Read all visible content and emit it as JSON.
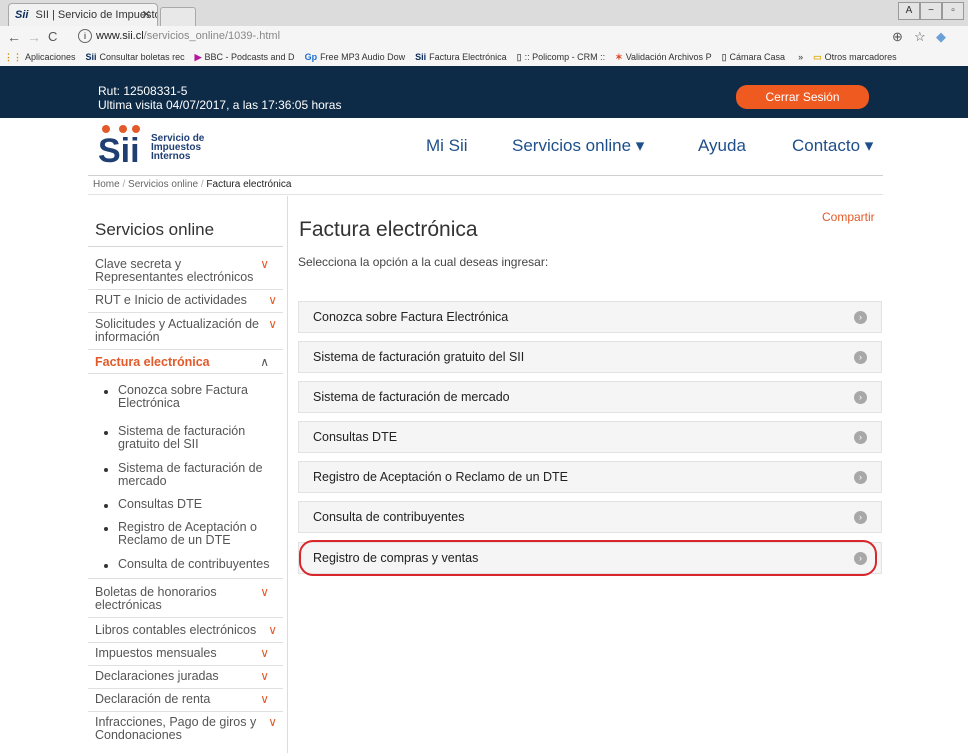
{
  "browser": {
    "tab_title": "SII | Servicio de Impuesto",
    "url_host": "www.sii.cl",
    "url_path": "/servicios_online/1039-.html",
    "bookmarks": [
      {
        "icon": "grid",
        "label": "Aplicaciones"
      },
      {
        "icon": "sii",
        "label": "Consultar boletas rec"
      },
      {
        "icon": "bbc",
        "label": "BBC - Podcasts and D"
      },
      {
        "icon": "mp3",
        "label": "Free MP3 Audio Dow"
      },
      {
        "icon": "sii",
        "label": "Factura Electrónica"
      },
      {
        "icon": "page",
        "label": ":: Policomp - CRM ::"
      },
      {
        "icon": "star",
        "label": "Validación Archivos P"
      },
      {
        "icon": "page",
        "label": "Cámara Casa"
      },
      {
        "icon": "more",
        "label": "»"
      },
      {
        "icon": "folder",
        "label": "Otros marcadores"
      }
    ]
  },
  "session": {
    "rut": "Rut: 12508331-5",
    "last_visit": "Ultima visita 04/07/2017, a las 17:36:05 horas",
    "logout_label": "Cerrar Sesión"
  },
  "header": {
    "logo_letters": "Sii",
    "logo_text": [
      "Servicio de",
      "Impuestos",
      "Internos"
    ],
    "nav": [
      "Mi Sii",
      "Servicios online ▾",
      "Ayuda",
      "Contacto ▾"
    ]
  },
  "breadcrumb": [
    "Home",
    "Servicios online",
    "Factura electrónica"
  ],
  "sidebar": {
    "title": "Servicios online",
    "items": [
      "Clave secreta y Representantes electrónicos",
      "RUT e Inicio de actividades",
      "Solicitudes y Actualización de información",
      "Factura electrónica",
      "Boletas de honorarios electrónicas",
      "Libros contables electrónicos",
      "Impuestos mensuales",
      "Declaraciones juradas",
      "Declaración de renta",
      "Infracciones, Pago de giros y Condonaciones"
    ],
    "subitems": [
      "Conozca sobre Factura Electrónica",
      "Sistema de facturación gratuito del SII",
      "Sistema de facturación de mercado",
      "Consultas DTE",
      "Registro de Aceptación o Reclamo de un DTE",
      "Consulta de contribuyentes"
    ]
  },
  "main": {
    "share": "Compartir",
    "title": "Factura electrónica",
    "subtitle": "Selecciona la opción a la cual deseas ingresar:",
    "options": [
      "Conozca sobre Factura Electrónica",
      "Sistema de facturación gratuito del SII",
      "Sistema de facturación de mercado",
      "Consultas DTE",
      "Registro de Aceptación o Reclamo de un DTE",
      "Consulta de contribuyentes",
      "Registro de compras y ventas"
    ]
  },
  "colors": {
    "brand_dark": "#0d2b47",
    "accent_orange": "#ef5a21",
    "link_blue": "#1f4f8a",
    "highlight_red": "#d8262b"
  }
}
